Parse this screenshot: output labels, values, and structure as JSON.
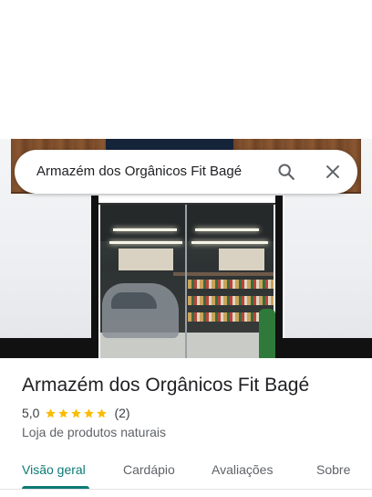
{
  "search": {
    "query": "Armazém dos Orgânicos Fit Bagé",
    "search_icon": "search-icon",
    "close_icon": "close-icon"
  },
  "place": {
    "name": "Armazém dos Orgânicos Fit Bagé",
    "rating": "5,0",
    "stars": 5,
    "review_count": "(2)",
    "category": "Loja de produtos naturais",
    "star_color": "#fbbc04"
  },
  "tabs": [
    {
      "label": "Visão geral",
      "active": true
    },
    {
      "label": "Cardápio",
      "active": false
    },
    {
      "label": "Avaliações",
      "active": false
    },
    {
      "label": "Sobre",
      "active": false
    }
  ],
  "colors": {
    "accent": "#0b7a74",
    "text_primary": "#202124",
    "text_secondary": "#5f6368"
  }
}
